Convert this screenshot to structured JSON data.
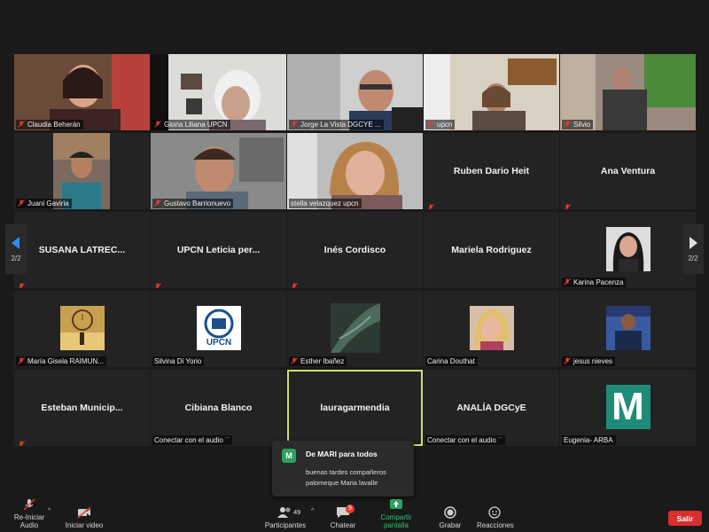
{
  "page": {
    "current": "2/2"
  },
  "participants": [
    {
      "name": "Claudia Beherán",
      "display": "video"
    },
    {
      "name": "Gloria Liliana UPCN",
      "display": "video"
    },
    {
      "name": "Jorge La Vista DGCYE ...",
      "display": "video"
    },
    {
      "name": "upcn",
      "display": "video"
    },
    {
      "name": "Silvio",
      "display": "video"
    },
    {
      "name": "Juani Gaviria",
      "display": "video"
    },
    {
      "name": "Gustavo Barrionuevo",
      "display": "video"
    },
    {
      "name": "stella velazquez upcn",
      "display": "video"
    },
    {
      "name": "Ruben Dario Heit",
      "display": "name"
    },
    {
      "name": "Ana Ventura",
      "display": "name"
    },
    {
      "name": "SUSANA  LATREC...",
      "display": "name"
    },
    {
      "name": "UPCN Leticia per...",
      "display": "name"
    },
    {
      "name": "Inés Cordisco",
      "display": "name"
    },
    {
      "name": "Mariela Rodriguez",
      "display": "name"
    },
    {
      "name": "Karina Pacenza",
      "display": "avatar"
    },
    {
      "name": "María Gisela RAIMUN...",
      "display": "avatar"
    },
    {
      "name": "Silvina Di Yorio",
      "display": "avatar"
    },
    {
      "name": "Esther Ibañez",
      "display": "avatar"
    },
    {
      "name": "Carina Douthat",
      "display": "avatar"
    },
    {
      "name": "jesus nieves",
      "display": "avatar"
    },
    {
      "name": "Esteban  Municip...",
      "display": "name"
    },
    {
      "name": "Cibiana Blanco",
      "display": "name",
      "status": "Conectar con el audio"
    },
    {
      "name": "lauragarmendia",
      "display": "name",
      "active": true
    },
    {
      "name": "ANALÍA DGCyE",
      "display": "name",
      "status": "Conectar con el audio"
    },
    {
      "name": "Eugenia- ARBA",
      "display": "avatar",
      "avatar_letter": "M"
    }
  ],
  "upcn_logo_text": "UPCN",
  "chat": {
    "sender_initial": "M",
    "from": "De MARI para todos",
    "line1": "buenas tardes compañeros",
    "line2": "palomeque Maria lavalle"
  },
  "toolbar": {
    "audio": "Re-Iniciar Audio",
    "video": "Iniciar video",
    "participants": "Participantes",
    "participant_count": "49",
    "chat": "Chatear",
    "chat_badge": "9",
    "share": "Compartir pantalla",
    "record": "Grabar",
    "reactions": "Reacciones",
    "leave": "Salir"
  },
  "colors": {
    "active_speaker": "#c9e26a",
    "share_green": "#2ea060",
    "leave_red": "#d92f2f",
    "mute_red": "#e53935"
  }
}
